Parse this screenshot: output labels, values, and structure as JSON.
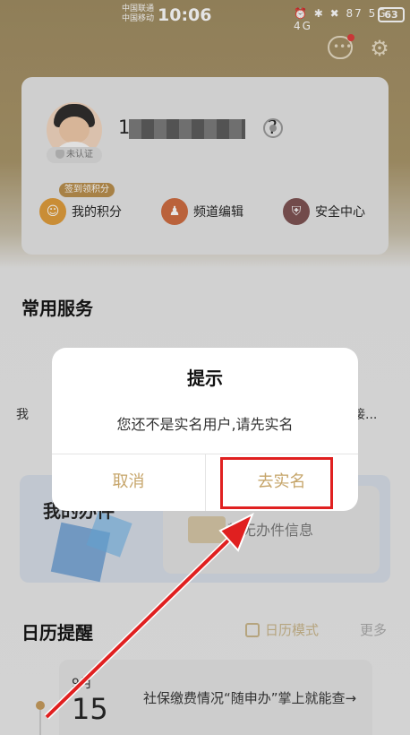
{
  "status_bar": {
    "carrier1": "中国联通",
    "carrier2": "中国移动",
    "time": "10:06",
    "icons": "⏰ ✱ ✖ 87 5G 4G",
    "battery": "63"
  },
  "profile": {
    "phone_prefix": "1",
    "phone_suffix": "?",
    "unverified_label": "未认证",
    "signin_pill": "签到领积分",
    "quick_links": [
      {
        "label": "我的积分",
        "icon": "coin-icon"
      },
      {
        "label": "频道编辑",
        "icon": "user-edit-icon"
      },
      {
        "label": "安全中心",
        "icon": "shield-icon"
      }
    ]
  },
  "services": {
    "title": "常用服务",
    "left_label": "我",
    "right_label": "接..."
  },
  "affairs": {
    "title": "我的办件",
    "empty_text": "暂无办件信息"
  },
  "calendar": {
    "title": "日历提醒",
    "mode_label": "日历模式",
    "more_label": "更多",
    "reminder": {
      "month": "9月",
      "day": "15",
      "text": "社保缴费情况“随申办”掌上就能查→"
    }
  },
  "dialog": {
    "title": "提示",
    "message": "您还不是实名用户,请先实名",
    "cancel_label": "取消",
    "confirm_label": "去实名"
  },
  "colors": {
    "accent": "#c6a56a",
    "highlight": "#e02020"
  }
}
